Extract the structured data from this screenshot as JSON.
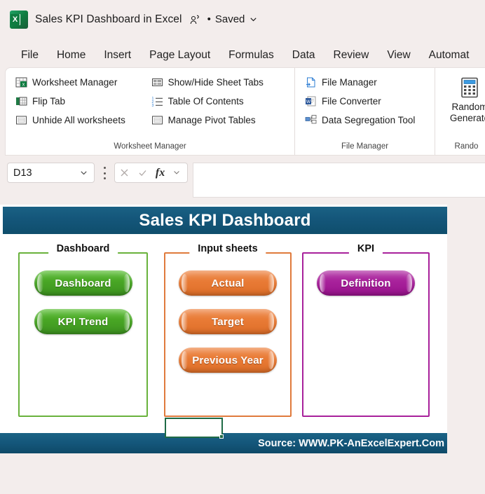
{
  "titlebar": {
    "app_icon": "excel-icon",
    "document_title": "Sales KPI Dashboard in Excel",
    "share_icon": "person-share-icon",
    "separator_dot": "•",
    "save_status": "Saved",
    "chevron_icon": "chevron-down-icon"
  },
  "ribbon": {
    "tabs": [
      "File",
      "Home",
      "Insert",
      "Page Layout",
      "Formulas",
      "Data",
      "Review",
      "View",
      "Automat"
    ],
    "groups": [
      {
        "label": "Worksheet Manager",
        "columns": [
          [
            {
              "icon": "worksheet-manager-icon",
              "label": "Worksheet Manager"
            },
            {
              "icon": "flip-tab-icon",
              "label": "Flip Tab"
            },
            {
              "icon": "unhide-worksheets-icon",
              "label": "Unhide All worksheets"
            }
          ],
          [
            {
              "icon": "show-hide-sheet-tabs-icon",
              "label": "Show/Hide Sheet Tabs"
            },
            {
              "icon": "table-of-contents-icon",
              "label": "Table Of Contents"
            },
            {
              "icon": "manage-pivot-tables-icon",
              "label": "Manage Pivot Tables"
            }
          ]
        ]
      },
      {
        "label": "File Manager",
        "columns": [
          [
            {
              "icon": "file-manager-icon",
              "label": "File Manager"
            },
            {
              "icon": "file-converter-icon",
              "label": "File Converter"
            },
            {
              "icon": "data-segregation-icon",
              "label": "Data Segregation Tool"
            }
          ]
        ]
      },
      {
        "label": "Rando",
        "big": {
          "icon": "calculator-icon",
          "line1": "Random",
          "line2": "Generato"
        }
      }
    ]
  },
  "formula_bar": {
    "name_box_value": "D13",
    "name_box_chevron": "chevron-down-icon",
    "more_options_icon": "kebab-menu-icon",
    "cancel_icon": "close-icon",
    "enter_icon": "check-icon",
    "function_icon": "fx",
    "function_chevron": "chevron-down-icon",
    "formula_value": ""
  },
  "dashboard": {
    "title": "Sales KPI Dashboard",
    "source_text": "Source: WWW.PK-AnExcelExpert.Com",
    "panels": [
      {
        "heading": "Dashboard",
        "color": "#69b23c",
        "button_style": "green",
        "buttons": [
          "Dashboard",
          "KPI Trend"
        ]
      },
      {
        "heading": "Input sheets",
        "color": "#e07a3c",
        "button_style": "orange",
        "buttons": [
          "Actual",
          "Target",
          "Previous Year"
        ]
      },
      {
        "heading": "KPI",
        "color": "#a8219b",
        "button_style": "purple",
        "buttons": [
          "Definition"
        ]
      }
    ],
    "selected_cell": "D13"
  }
}
